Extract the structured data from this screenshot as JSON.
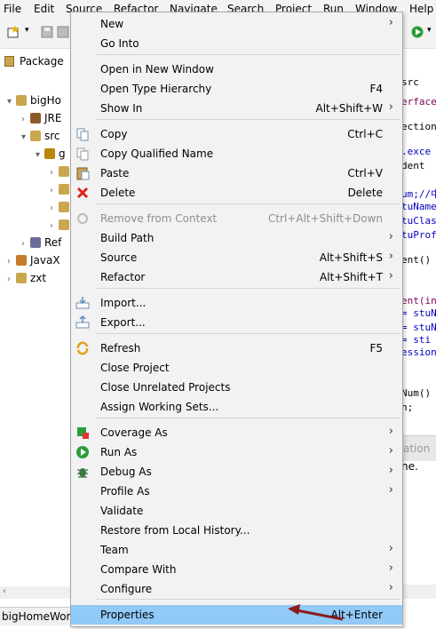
{
  "menubar": [
    "File",
    "Edit",
    "Source",
    "Refactor",
    "Navigate",
    "Search",
    "Project",
    "Run",
    "Window",
    "Help"
  ],
  "package_explorer": {
    "tab_label": "Package",
    "tree": [
      {
        "label": "bigHo",
        "arrow": "▾",
        "indent": 0
      },
      {
        "label": "JRE",
        "arrow": "›",
        "indent": 1
      },
      {
        "label": "src",
        "arrow": "▾",
        "indent": 1
      },
      {
        "label": "g",
        "arrow": "▾",
        "indent": 2
      },
      {
        "label": "",
        "arrow": "›",
        "indent": 3
      },
      {
        "label": "",
        "arrow": "›",
        "indent": 3
      },
      {
        "label": "",
        "arrow": "›",
        "indent": 3
      },
      {
        "label": "",
        "arrow": "›",
        "indent": 3
      },
      {
        "label": "Ref",
        "arrow": "›",
        "indent": 1
      },
      {
        "label": "JavaX",
        "arrow": "›",
        "indent": 0
      },
      {
        "label": "zxt",
        "arrow": "›",
        "indent": 0
      }
    ],
    "status_text": "bigHomeWor"
  },
  "editor": {
    "lines": [
      "src",
      "erface",
      "ection",
      ".exce",
      "dent",
      "um;//中",
      "tuName",
      "tuClas",
      "tuProf",
      "ent()",
      "ent(in",
      "= stuN",
      "= stuN",
      "= sti",
      "ession",
      "Num()",
      "n;"
    ],
    "right_tab": "ation",
    "right_text": "ne."
  },
  "context_menu": {
    "items": [
      {
        "label": "New",
        "shortcut": "",
        "submenu": true,
        "icon": "",
        "state": "normal"
      },
      {
        "label": "Go Into",
        "shortcut": "",
        "submenu": false,
        "icon": "",
        "state": "normal"
      },
      {
        "label": "Open in New Window",
        "shortcut": "",
        "submenu": false,
        "icon": "",
        "state": "normal"
      },
      {
        "label": "Open Type Hierarchy",
        "shortcut": "F4",
        "submenu": false,
        "icon": "",
        "state": "normal"
      },
      {
        "label": "Show In",
        "shortcut": "Alt+Shift+W",
        "submenu": true,
        "icon": "",
        "state": "normal"
      },
      {
        "label": "Copy",
        "shortcut": "Ctrl+C",
        "submenu": false,
        "icon": "copy-icon",
        "state": "normal"
      },
      {
        "label": "Copy Qualified Name",
        "shortcut": "",
        "submenu": false,
        "icon": "copy-qualified-icon",
        "state": "normal"
      },
      {
        "label": "Paste",
        "shortcut": "Ctrl+V",
        "submenu": false,
        "icon": "paste-icon",
        "state": "normal"
      },
      {
        "label": "Delete",
        "shortcut": "Delete",
        "submenu": false,
        "icon": "delete-icon",
        "state": "normal"
      },
      {
        "label": "Remove from Context",
        "shortcut": "Ctrl+Alt+Shift+Down",
        "submenu": false,
        "icon": "remove-context-icon",
        "state": "disabled"
      },
      {
        "label": "Build Path",
        "shortcut": "",
        "submenu": true,
        "icon": "",
        "state": "normal"
      },
      {
        "label": "Source",
        "shortcut": "Alt+Shift+S",
        "submenu": true,
        "icon": "",
        "state": "normal"
      },
      {
        "label": "Refactor",
        "shortcut": "Alt+Shift+T",
        "submenu": true,
        "icon": "",
        "state": "normal"
      },
      {
        "label": "Import...",
        "shortcut": "",
        "submenu": false,
        "icon": "import-icon",
        "state": "normal"
      },
      {
        "label": "Export...",
        "shortcut": "",
        "submenu": false,
        "icon": "export-icon",
        "state": "normal"
      },
      {
        "label": "Refresh",
        "shortcut": "F5",
        "submenu": false,
        "icon": "refresh-icon",
        "state": "normal"
      },
      {
        "label": "Close Project",
        "shortcut": "",
        "submenu": false,
        "icon": "",
        "state": "normal"
      },
      {
        "label": "Close Unrelated Projects",
        "shortcut": "",
        "submenu": false,
        "icon": "",
        "state": "normal"
      },
      {
        "label": "Assign Working Sets...",
        "shortcut": "",
        "submenu": false,
        "icon": "",
        "state": "normal"
      },
      {
        "label": "Coverage As",
        "shortcut": "",
        "submenu": true,
        "icon": "coverage-icon",
        "state": "normal"
      },
      {
        "label": "Run As",
        "shortcut": "",
        "submenu": true,
        "icon": "run-icon",
        "state": "normal"
      },
      {
        "label": "Debug As",
        "shortcut": "",
        "submenu": true,
        "icon": "debug-icon",
        "state": "normal"
      },
      {
        "label": "Profile As",
        "shortcut": "",
        "submenu": true,
        "icon": "",
        "state": "normal"
      },
      {
        "label": "Validate",
        "shortcut": "",
        "submenu": false,
        "icon": "",
        "state": "normal"
      },
      {
        "label": "Restore from Local History...",
        "shortcut": "",
        "submenu": false,
        "icon": "",
        "state": "normal"
      },
      {
        "label": "Team",
        "shortcut": "",
        "submenu": true,
        "icon": "",
        "state": "normal"
      },
      {
        "label": "Compare With",
        "shortcut": "",
        "submenu": true,
        "icon": "",
        "state": "normal"
      },
      {
        "label": "Configure",
        "shortcut": "",
        "submenu": true,
        "icon": "",
        "state": "normal"
      },
      {
        "label": "Properties",
        "shortcut": "Alt+Enter",
        "submenu": false,
        "icon": "",
        "state": "selected"
      }
    ]
  },
  "colors": {
    "menu_bg": "#f2f2f2",
    "selected_bg": "#91c9f7",
    "annotation_arrow": "#8b1a1a",
    "disabled_text": "#8f8f8f"
  }
}
